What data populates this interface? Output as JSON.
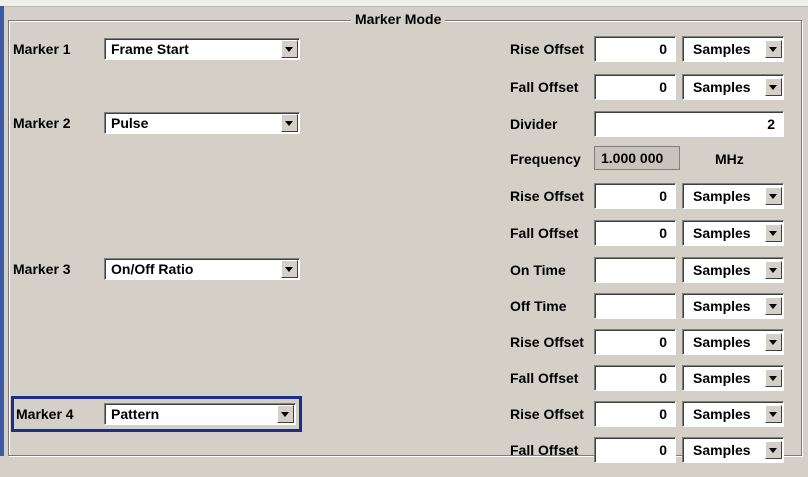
{
  "frame_title": "Marker Mode",
  "markers": [
    {
      "label": "Marker 1",
      "mode": "Frame Start"
    },
    {
      "label": "Marker 2",
      "mode": "Pulse"
    },
    {
      "label": "Marker 3",
      "mode": "On/Off Ratio"
    },
    {
      "label": "Marker 4",
      "mode": "Pattern"
    }
  ],
  "params": {
    "m1_rise": {
      "label": "Rise Offset",
      "value": "0",
      "unit": "Samples"
    },
    "m1_fall": {
      "label": "Fall Offset",
      "value": "0",
      "unit": "Samples"
    },
    "m2_divider": {
      "label": "Divider",
      "value": "2"
    },
    "m2_frequency": {
      "label": "Frequency",
      "value": "1.000 000",
      "unit": "MHz"
    },
    "m2_rise": {
      "label": "Rise Offset",
      "value": "0",
      "unit": "Samples"
    },
    "m2_fall": {
      "label": "Fall Offset",
      "value": "0",
      "unit": "Samples"
    },
    "m3_on": {
      "label": "On Time",
      "value": "",
      "unit": "Samples"
    },
    "m3_off": {
      "label": "Off Time",
      "value": "",
      "unit": "Samples"
    },
    "m3_rise": {
      "label": "Rise Offset",
      "value": "0",
      "unit": "Samples"
    },
    "m3_fall": {
      "label": "Fall Offset",
      "value": "0",
      "unit": "Samples"
    },
    "m4_rise": {
      "label": "Rise Offset",
      "value": "0",
      "unit": "Samples"
    },
    "m4_fall": {
      "label": "Fall Offset",
      "value": "0",
      "unit": "Samples"
    }
  },
  "icons": {
    "dropdown": "chevron-down-icon"
  },
  "colors": {
    "background": "#d4d0c8",
    "focus_border": "#1c2e8c",
    "left_accent": "#3c5aa8"
  }
}
